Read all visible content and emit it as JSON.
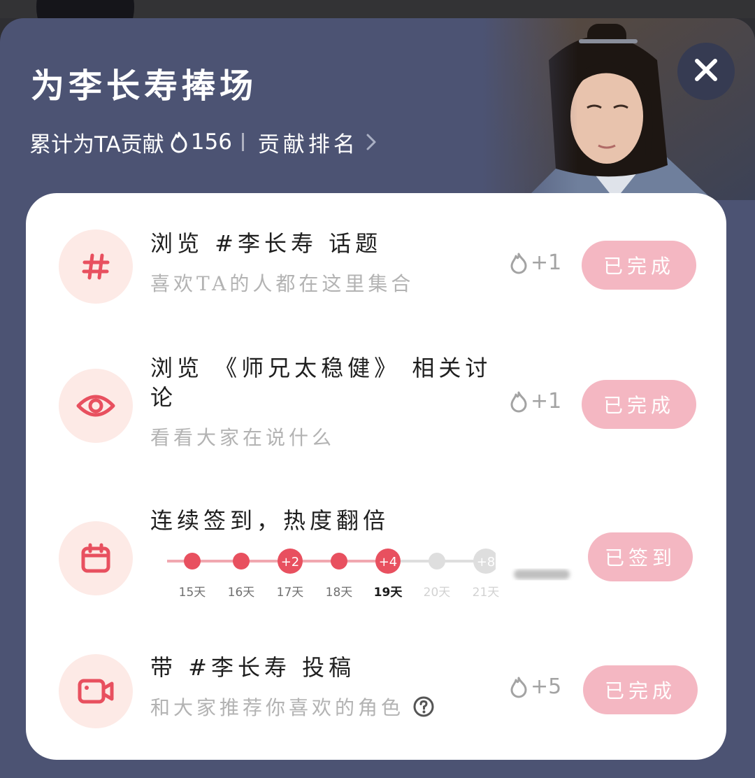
{
  "header": {
    "title": "为李长寿捧场",
    "contrib_prefix": "累计为TA贡献",
    "contrib_value": "156",
    "rank_label": "贡献排名"
  },
  "tasks": [
    {
      "icon": "hash-icon",
      "title": "浏览 #李长寿 话题",
      "subtitle": "喜欢TA的人都在这里集合",
      "reward": "+1",
      "status": "已完成"
    },
    {
      "icon": "eye-icon",
      "title_line1": "浏览 《师兄太稳健》 相关讨",
      "title_line2": "论",
      "subtitle": "看看大家在说什么",
      "reward": "+1",
      "status": "已完成"
    },
    {
      "icon": "calendar-icon",
      "title": "连续签到，热度翻倍",
      "status": "已签到",
      "days": [
        {
          "label": "15天",
          "state": "done",
          "badge": ""
        },
        {
          "label": "16天",
          "state": "done",
          "badge": ""
        },
        {
          "label": "17天",
          "state": "done",
          "badge": "+2"
        },
        {
          "label": "18天",
          "state": "done",
          "badge": ""
        },
        {
          "label": "19天",
          "state": "today",
          "badge": "+4"
        },
        {
          "label": "20天",
          "state": "future",
          "badge": ""
        },
        {
          "label": "21天",
          "state": "future",
          "badge": "+8"
        }
      ]
    },
    {
      "icon": "video-icon",
      "title": "带 #李长寿 投稿",
      "subtitle": "和大家推荐你喜欢的角色",
      "reward": "+5",
      "status": "已完成"
    }
  ],
  "colors": {
    "sheet_bg": "#4c5373",
    "accent": "#e8505f",
    "done_button": "#f4b7c2",
    "icon_bg": "#fdeae6"
  }
}
